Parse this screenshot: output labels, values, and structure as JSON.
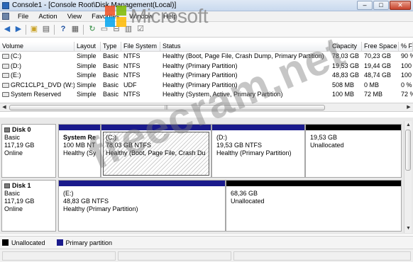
{
  "window": {
    "title": "Console1 - [Console Root\\Disk Management(Local)]",
    "buttons": {
      "minimize": "–",
      "maximize": "□",
      "close": "✕"
    }
  },
  "menu": [
    "File",
    "Action",
    "View",
    "Favorites",
    "Window",
    "Help"
  ],
  "toolbar": {
    "icons": [
      "back-icon",
      "forward-icon",
      "up-folder-icon",
      "show-tree-icon",
      "help-icon",
      "properties-icon",
      "refresh-icon",
      "connect-icon",
      "rescan-icon",
      "export-icon",
      "checklist-icon"
    ]
  },
  "brand": {
    "wordmark": "Microsoft",
    "colors": [
      "#f25022",
      "#7fba00",
      "#00a4ef",
      "#ffb900"
    ]
  },
  "volume_table": {
    "columns": [
      "Volume",
      "Layout",
      "Type",
      "File System",
      "Status",
      "Capacity",
      "Free Space",
      "% F"
    ],
    "rows": [
      [
        "(C:)",
        "Simple",
        "Basic",
        "NTFS",
        "Healthy (Boot, Page File, Crash Dump, Primary Partition)",
        "78,03 GB",
        "70,23 GB",
        "90 %"
      ],
      [
        "(D:)",
        "Simple",
        "Basic",
        "NTFS",
        "Healthy (Primary Partition)",
        "19,53 GB",
        "19,44 GB",
        "100"
      ],
      [
        "(E:)",
        "Simple",
        "Basic",
        "NTFS",
        "Healthy (Primary Partition)",
        "48,83 GB",
        "48,74 GB",
        "100"
      ],
      [
        "GRC1CLP1_DVD (W:)",
        "Simple",
        "Basic",
        "UDF",
        "Healthy (Primary Partition)",
        "508 MB",
        "0 MB",
        "0 %"
      ],
      [
        "System Reserved",
        "Simple",
        "Basic",
        "NTFS",
        "Healthy (System, Active, Primary Partition)",
        "100 MB",
        "72 MB",
        "72 %"
      ]
    ]
  },
  "disks": [
    {
      "name": "Disk 0",
      "type": "Basic",
      "size": "117,19 GB",
      "status": "Online",
      "partitions": [
        {
          "name": "System Res",
          "size": "100 MB NTF",
          "status": "Healthy (Sys"
        },
        {
          "name": "(C:)",
          "size": "78,03 GB NTFS",
          "status": "Healthy (Boot, Page File, Crash Du"
        },
        {
          "name": "(D:)",
          "size": "19,53 GB NTFS",
          "status": "Healthy (Primary Partition)"
        },
        {
          "name": "",
          "size": "19,53 GB",
          "status": "Unallocated"
        }
      ]
    },
    {
      "name": "Disk 1",
      "type": "Basic",
      "size": "117,19 GB",
      "status": "Online",
      "partitions": [
        {
          "name": "(E:)",
          "size": "48,83 GB NTFS",
          "status": "Healthy (Primary Partition)"
        },
        {
          "name": "",
          "size": "68,36 GB",
          "status": "Unallocated"
        }
      ]
    }
  ],
  "legend": [
    {
      "label": "Unallocated",
      "color": "#000000"
    },
    {
      "label": "Primary partition",
      "color": "#1a1a8c"
    }
  ],
  "colors": {
    "primary_band": "#1a1a8c",
    "unallocated_band": "#000000"
  },
  "watermark": "freecram.net"
}
